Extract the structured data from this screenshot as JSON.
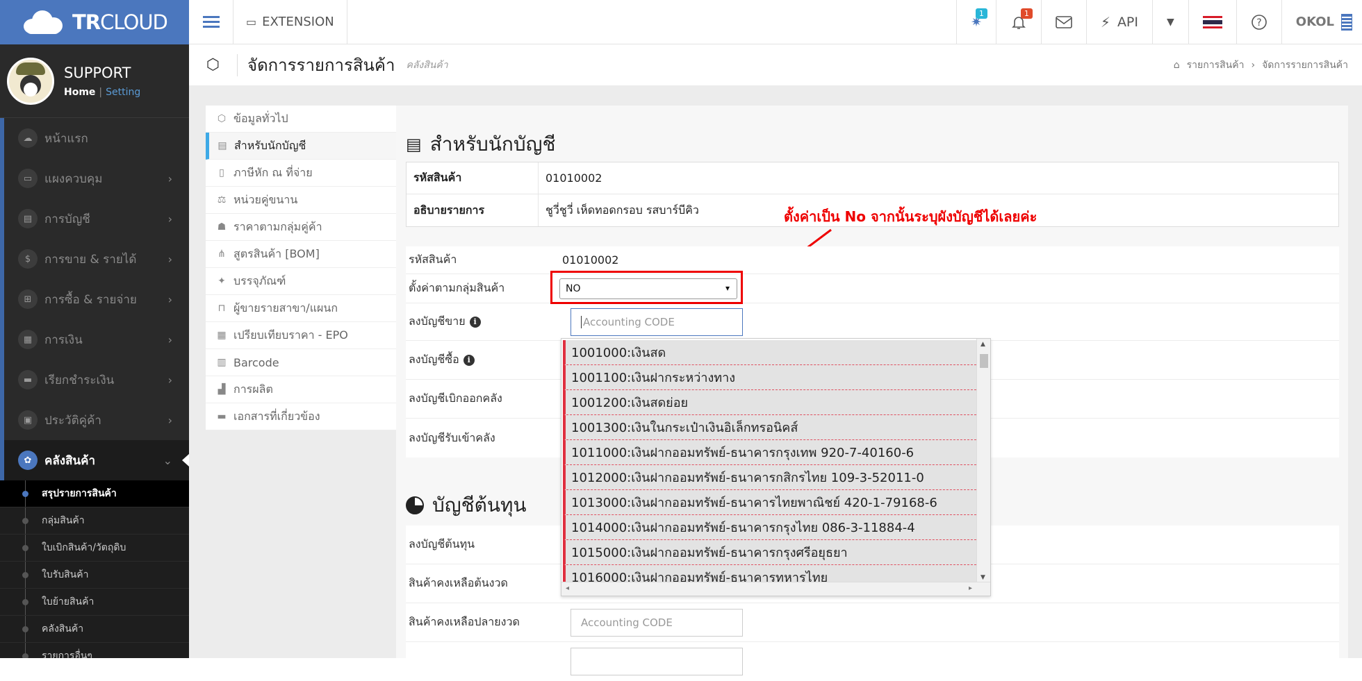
{
  "brand": {
    "logo_bold": "TR",
    "logo_rest": "CLOUD"
  },
  "profile": {
    "name": "SUPPORT",
    "home": "Home",
    "sep": "|",
    "setting": "Setting"
  },
  "menu": [
    {
      "label": "หน้าแรก",
      "icon": "☁",
      "chev": ""
    },
    {
      "label": "แผงควบคุม",
      "icon": "▭",
      "chev": "›"
    },
    {
      "label": "การบัญชี",
      "icon": "▤",
      "chev": "›"
    },
    {
      "label": "การขาย & รายได้",
      "icon": "$",
      "chev": "›"
    },
    {
      "label": "การซื้อ & รายจ่าย",
      "icon": "⊞",
      "chev": "›"
    },
    {
      "label": "การเงิน",
      "icon": "▦",
      "chev": "›"
    },
    {
      "label": "เรียกชำระเงิน",
      "icon": "▬",
      "chev": "›"
    },
    {
      "label": "ประวัติคู่ค้า",
      "icon": "▣",
      "chev": "›"
    },
    {
      "label": "คลังสินค้า",
      "icon": "✿",
      "chev": "⌄"
    }
  ],
  "submenu": [
    "สรุปรายการสินค้า",
    "กลุ่มสินค้า",
    "ใบเบิกสินค้า/วัตถุดิบ",
    "ใบรับสินค้า",
    "ใบย้ายสินค้า",
    "คลังสินค้า",
    "รายการอื่นๆ"
  ],
  "topbar": {
    "extension": "EXTENSION",
    "badge_blue": "1",
    "badge_red": "1",
    "api": "API",
    "user": "OKOL",
    "colors": {
      "accent": "#4b77be",
      "badge_blue": "#29b6d8",
      "badge_red": "#e04b2b"
    }
  },
  "page": {
    "title": "จัดการรายการสินค้า",
    "subtitle": "คลังสินค้า",
    "breadcrumb": [
      "รายการสินค้า",
      "จัดการรายการสินค้า"
    ]
  },
  "tabs": [
    {
      "label": "ข้อมูลทั่วไป",
      "icon": "⬡"
    },
    {
      "label": "สำหรับนักบัญชี",
      "icon": "▤"
    },
    {
      "label": "ภาษีหัก ณ ที่จ่าย",
      "icon": "▯"
    },
    {
      "label": "หน่วยคู่ขนาน",
      "icon": "⚖"
    },
    {
      "label": "ราคาตามกลุ่มคู่ค้า",
      "icon": "☗"
    },
    {
      "label": "สูตรสินค้า [BOM]",
      "icon": "⋔"
    },
    {
      "label": "บรรจุภัณฑ์",
      "icon": "✦"
    },
    {
      "label": "ผู้ขายรายสาขา/แผนก",
      "icon": "⊓"
    },
    {
      "label": "เปรียบเทียบราคา - EPO",
      "icon": "▦"
    },
    {
      "label": "Barcode",
      "icon": "▥"
    },
    {
      "label": "การผลิต",
      "icon": "▟"
    },
    {
      "label": "เอกสารที่เกี่ยวข้อง",
      "icon": "▬"
    }
  ],
  "section": {
    "title": "สำหรับนักบัญชี",
    "info": [
      {
        "key": "รหัสสินค้า",
        "value": "01010002"
      },
      {
        "key": "อธิบายรายการ",
        "value": "ชูวี่ชูวี่ เห็ดทอดกรอบ รสบาร์บีคิว"
      }
    ],
    "fields": {
      "code_label": "รหัสสินค้า",
      "code_value": "01010002",
      "group_label": "ตั้งค่าตามกลุ่มสินค้า",
      "group_value": "NO",
      "sale_label": "ลงบัญชีขาย",
      "purchase_label": "ลงบัญชีซื้อ",
      "issue_label": "ลงบัญชีเบิกออกคลัง",
      "receive_label": "ลงบัญชีรับเข้าคลัง",
      "placeholder": "Accounting CODE"
    }
  },
  "annotation": "ตั้งค่าเป็น No จากนั้นระบุผังบัญชีได้เลยค่ะ",
  "section2": {
    "title": "บัญชีต้นทุน",
    "fields": [
      "ลงบัญชีต้นทุน",
      "สินค้าคงเหลือต้นงวด",
      "สินค้าคงเหลือปลายงวด"
    ]
  },
  "dropdown": [
    "1001000:เงินสด",
    "1001100:เงินฝากระหว่างทาง",
    "1001200:เงินสดย่อย",
    "1001300:เงินในกระเป๋าเงินอิเล็กทรอนิคส์",
    "1011000:เงินฝากออมทรัพย์-ธนาคารกรุงเทพ 920-7-40160-6",
    "1012000:เงินฝากออมทรัพย์-ธนาคารกสิกรไทย 109-3-52011-0",
    "1013000:เงินฝากออมทรัพย์-ธนาคารไทยพาณิชย์ 420-1-79168-6",
    "1014000:เงินฝากออมทรัพย์-ธนาคารกรุงไทย 086-3-11884-4",
    "1015000:เงินฝากออมทรัพย์-ธนาคารกรุงศรีอยุธยา",
    "1016000:เงินฝากออมทรัพย์-ธนาคารทหารไทย"
  ]
}
